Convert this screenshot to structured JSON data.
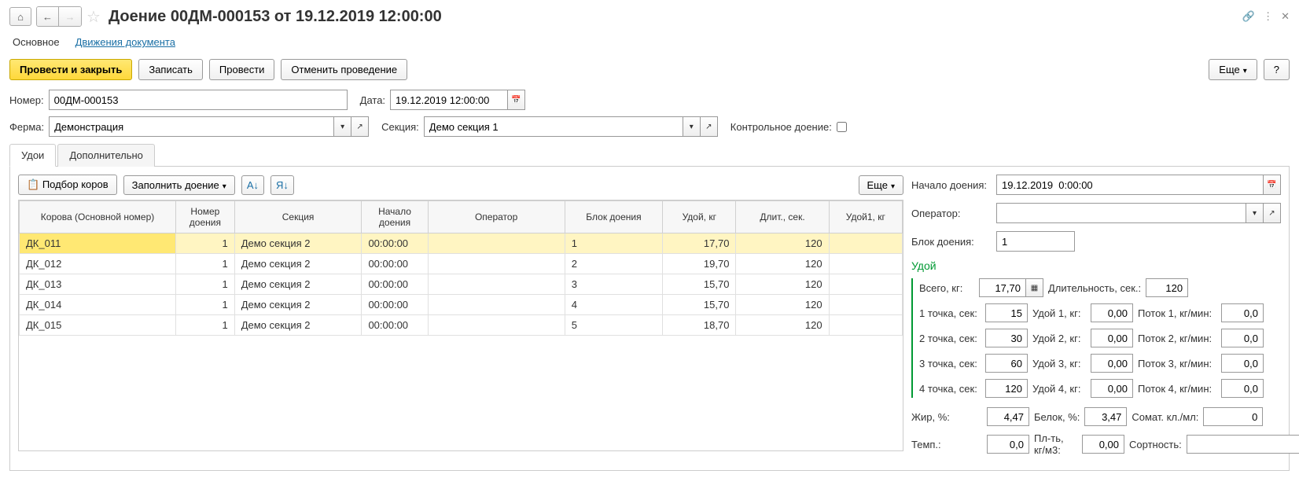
{
  "header": {
    "title": "Доение 00ДМ-000153 от 19.12.2019 12:00:00"
  },
  "mainTabs": {
    "main": "Основное",
    "movements": "Движения документа"
  },
  "toolbar": {
    "postAndClose": "Провести и закрыть",
    "save": "Записать",
    "post": "Провести",
    "cancelPost": "Отменить проведение",
    "more": "Еще",
    "help": "?"
  },
  "fields": {
    "numberLabel": "Номер:",
    "numberValue": "00ДМ-000153",
    "dateLabel": "Дата:",
    "dateValue": "19.12.2019 12:00:00",
    "farmLabel": "Ферма:",
    "farmValue": "Демонстрация",
    "sectionLabel": "Секция:",
    "sectionValue": "Демо секция 1",
    "controlLabel": "Контрольное доение:"
  },
  "subTabs": {
    "udoi": "Удои",
    "additional": "Дополнительно"
  },
  "tableToolbar": {
    "pickCows": "Подбор коров",
    "fillMilking": "Заполнить доение",
    "more": "Еще"
  },
  "columns": {
    "cow": "Корова (Основной номер)",
    "milkNum": "Номер доения",
    "section": "Секция",
    "start": "Начало доения",
    "operator": "Оператор",
    "block": "Блок доения",
    "yield": "Удой, кг",
    "duration": "Длит., сек.",
    "yield1": "Удой1, кг"
  },
  "rows": [
    {
      "cow": "ДК_011",
      "num": "1",
      "section": "Демо секция 2",
      "start": "00:00:00",
      "operator": "",
      "block": "1",
      "yield": "17,70",
      "dur": "120",
      "y1": ""
    },
    {
      "cow": "ДК_012",
      "num": "1",
      "section": "Демо секция 2",
      "start": "00:00:00",
      "operator": "",
      "block": "2",
      "yield": "19,70",
      "dur": "120",
      "y1": ""
    },
    {
      "cow": "ДК_013",
      "num": "1",
      "section": "Демо секция 2",
      "start": "00:00:00",
      "operator": "",
      "block": "3",
      "yield": "15,70",
      "dur": "120",
      "y1": ""
    },
    {
      "cow": "ДК_014",
      "num": "1",
      "section": "Демо секция 2",
      "start": "00:00:00",
      "operator": "",
      "block": "4",
      "yield": "15,70",
      "dur": "120",
      "y1": ""
    },
    {
      "cow": "ДК_015",
      "num": "1",
      "section": "Демо секция 2",
      "start": "00:00:00",
      "operator": "",
      "block": "5",
      "yield": "18,70",
      "dur": "120",
      "y1": ""
    }
  ],
  "detail": {
    "startLabel": "Начало доения:",
    "startValue": "19.12.2019  0:00:00",
    "operatorLabel": "Оператор:",
    "operatorValue": "",
    "blockLabel": "Блок доения:",
    "blockValue": "1",
    "sectionTitle": "Удой",
    "totalLabel": "Всего, кг:",
    "totalValue": "17,70",
    "durationLabel": "Длительность, сек.:",
    "durationValue": "120",
    "points": [
      {
        "pl": "1 точка, сек:",
        "pv": "15",
        "ul": "Удой 1, кг:",
        "uv": "0,00",
        "fl": "Поток 1, кг/мин:",
        "fv": "0,0"
      },
      {
        "pl": "2 точка, сек:",
        "pv": "30",
        "ul": "Удой 2, кг:",
        "uv": "0,00",
        "fl": "Поток 2, кг/мин:",
        "fv": "0,0"
      },
      {
        "pl": "3 точка, сек:",
        "pv": "60",
        "ul": "Удой 3, кг:",
        "uv": "0,00",
        "fl": "Поток 3, кг/мин:",
        "fv": "0,0"
      },
      {
        "pl": "4 точка, сек:",
        "pv": "120",
        "ul": "Удой 4, кг:",
        "uv": "0,00",
        "fl": "Поток 4, кг/мин:",
        "fv": "0,0"
      }
    ],
    "fatLabel": "Жир, %:",
    "fatValue": "4,47",
    "proteinLabel": "Белок, %:",
    "proteinValue": "3,47",
    "somatLabel": "Сомат. кл./мл:",
    "somatValue": "0",
    "tempLabel": "Темп.:",
    "tempValue": "0,0",
    "densityLabel": "Пл-ть, кг/м3:",
    "densityValue": "0,00",
    "gradeLabel": "Сортность:",
    "gradeValue": ""
  }
}
